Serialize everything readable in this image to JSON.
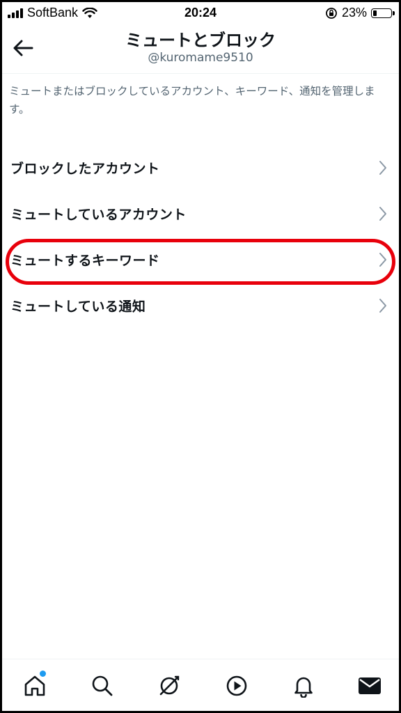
{
  "status_bar": {
    "carrier": "SoftBank",
    "time": "20:24",
    "battery": "23%",
    "battery_level": 0.23
  },
  "header": {
    "title": "ミュートとブロック",
    "username": "@kuromame9510",
    "back_icon": "arrow-left-icon"
  },
  "description": "ミュートまたはブロックしているアカウント、キーワード、通知を管理します。",
  "menu": {
    "items": [
      {
        "label": "ブロックしたアカウント"
      },
      {
        "label": "ミュートしているアカウント"
      },
      {
        "label": "ミュートするキーワード"
      },
      {
        "label": "ミュートしている通知"
      }
    ]
  },
  "colors": {
    "text_primary": "#0f1419",
    "text_secondary": "#536471",
    "accent": "#1d9bf0",
    "highlight": "#e8000b"
  },
  "bottom_nav": {
    "items": [
      "home-icon",
      "search-icon",
      "spaces-icon",
      "video-icon",
      "notifications-icon",
      "messages-icon"
    ]
  }
}
